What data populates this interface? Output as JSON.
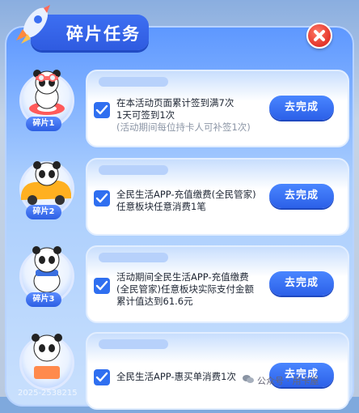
{
  "header": {
    "title": "碎片任务"
  },
  "tasks": [
    {
      "piece_label": "碎片1",
      "lines": [
        "在本活动页面累计签到满7次",
        "1天可签到1次"
      ],
      "note": "(活动期间每位持卡人可补签1次)",
      "button_label": "去完成"
    },
    {
      "piece_label": "碎片2",
      "lines": [
        "全民生活APP-充值缴费(全民管家)",
        "任意板块任意消费1笔"
      ],
      "note": "",
      "button_label": "去完成"
    },
    {
      "piece_label": "碎片3",
      "lines": [
        "活动期间全民生活APP-充值缴费",
        "(全民管家)任意板块实际支付金额",
        "累计值达到61.6元"
      ],
      "note": "",
      "button_label": "去完成"
    },
    {
      "piece_label": "",
      "lines": [
        "全民生活APP-惠买单消费1次"
      ],
      "note": "",
      "button_label": "去完成"
    }
  ],
  "watermark": "公众号 · 用卡屋",
  "footer_code": "2025-2538215",
  "colors": {
    "accent": "#2f6ff0",
    "close": "#e3342a"
  }
}
